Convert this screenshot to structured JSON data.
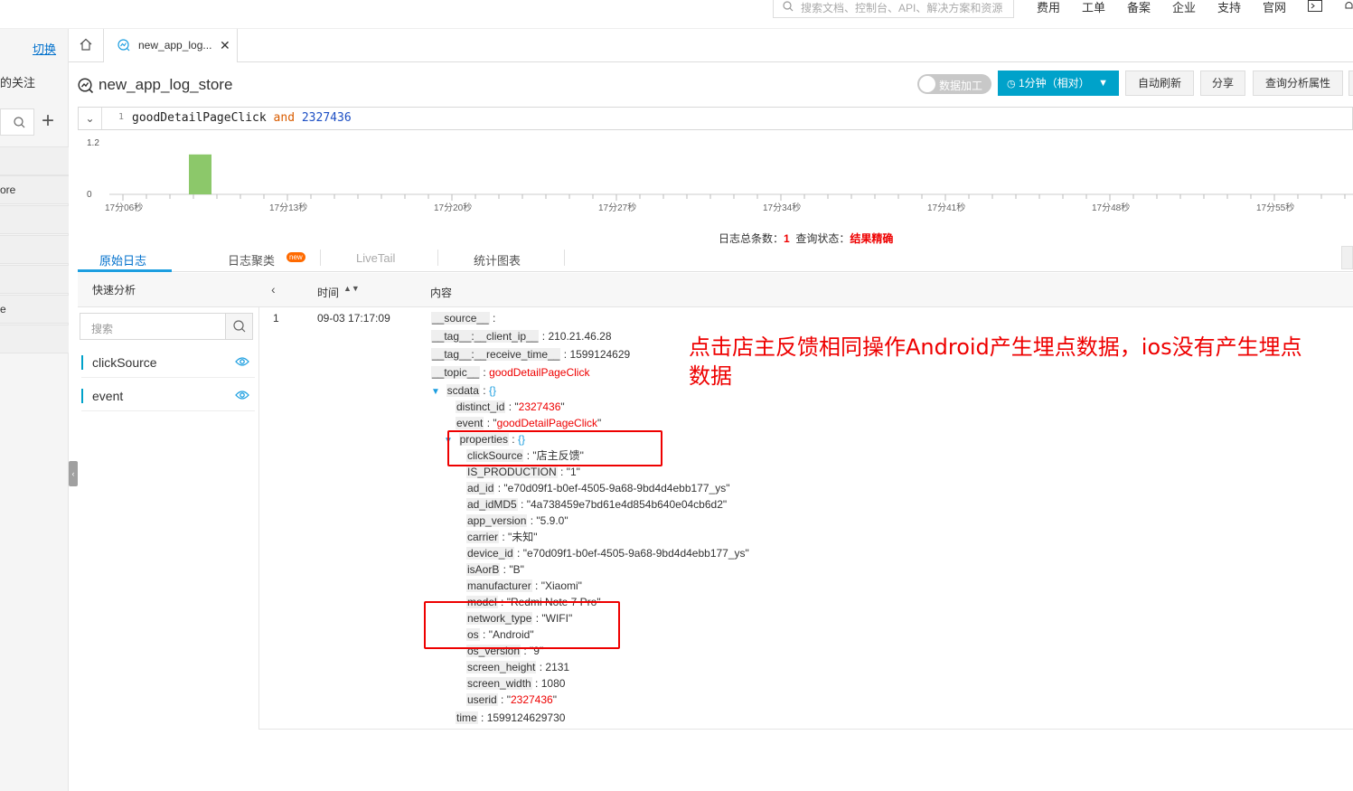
{
  "topnav": {
    "search_placeholder": "搜索文档、控制台、API、解决方案和资源",
    "links": [
      "费用",
      "工单",
      "备案",
      "企业",
      "支持",
      "官网"
    ]
  },
  "sidebar": {
    "switch_label": "切换",
    "follow_label": "的关注",
    "items": [
      "ore",
      "e"
    ]
  },
  "tabs": {
    "log_tab_label": "new_app_log..."
  },
  "header": {
    "title": "new_app_log_store",
    "toggle_label": "数据加工",
    "time_button": "1分钟（相对）",
    "auto_refresh": "自动刷新",
    "share": "分享",
    "query_props": "查询分析属性"
  },
  "query": {
    "line_number": "1",
    "term1": "goodDetailPageClick",
    "operator": "and",
    "term2": "2327436"
  },
  "chart_data": {
    "type": "bar",
    "ylim": [
      0,
      1.2
    ],
    "y_ticks": [
      "1.2",
      "0"
    ],
    "x_tick_labels": [
      "17分06秒",
      "17分13秒",
      "17分20秒",
      "17分27秒",
      "17分34秒",
      "17分41秒",
      "17分48秒",
      "17分55秒"
    ],
    "bars": [
      {
        "x": "17分09秒",
        "value": 1
      }
    ],
    "bar_color": "#8cc86a"
  },
  "status": {
    "total_label": "日志总条数：",
    "total": "1",
    "state_label": "查询状态：",
    "state": "结果精确"
  },
  "content_tabs": {
    "raw": "原始日志",
    "cluster": "日志聚类",
    "cluster_badge": "new",
    "livetail": "LiveTail",
    "stats": "统计图表"
  },
  "quick": {
    "title": "快速分析",
    "search_placeholder": "搜索",
    "fields": [
      "clickSource",
      "event"
    ]
  },
  "log_header": {
    "time": "时间",
    "content": "内容"
  },
  "log": {
    "index": "1",
    "time": "09-03 17:17:09",
    "source_key": "__source__",
    "client_ip_key": "__tag__:__client_ip__",
    "client_ip": "210.21.46.28",
    "receive_time_key": "__tag__:__receive_time__",
    "receive_time": "1599124629",
    "topic_key": "__topic__",
    "topic": "goodDetailPageClick",
    "scdata_key": "scdata",
    "distinct_id_key": "distinct_id",
    "distinct_id": "2327436",
    "event_key": "event",
    "event": "goodDetailPageClick",
    "properties_key": "properties",
    "props": [
      {
        "k": "clickSource",
        "v": "\"店主反馈\""
      },
      {
        "k": "IS_PRODUCTION",
        "v": "\"1\""
      },
      {
        "k": "ad_id",
        "v": "\"e70d09f1-b0ef-4505-9a68-9bd4d4ebb177_ys\""
      },
      {
        "k": "ad_idMD5",
        "v": "\"4a738459e7bd61e4d854b640e04cb6d2\""
      },
      {
        "k": "app_version",
        "v": "\"5.9.0\""
      },
      {
        "k": "carrier",
        "v": "\"未知\""
      },
      {
        "k": "device_id",
        "v": "\"e70d09f1-b0ef-4505-9a68-9bd4d4ebb177_ys\""
      },
      {
        "k": "isAorB",
        "v": "\"B\""
      },
      {
        "k": "manufacturer",
        "v": "\"Xiaomi\""
      },
      {
        "k": "model",
        "v": "\"Redmi Note 7 Pro\""
      },
      {
        "k": "network_type",
        "v": "\"WIFI\""
      },
      {
        "k": "os",
        "v": "\"Android\""
      },
      {
        "k": "os_version",
        "v": "\"9\""
      },
      {
        "k": "screen_height",
        "v": "2131"
      },
      {
        "k": "screen_width",
        "v": "1080"
      }
    ],
    "userid_key": "userid",
    "userid": "2327436",
    "time_key": "time",
    "time_value": "1599124629730"
  },
  "annotation": "点击店主反馈相同操作Android产生埋点数据，ios没有产生埋点数据"
}
